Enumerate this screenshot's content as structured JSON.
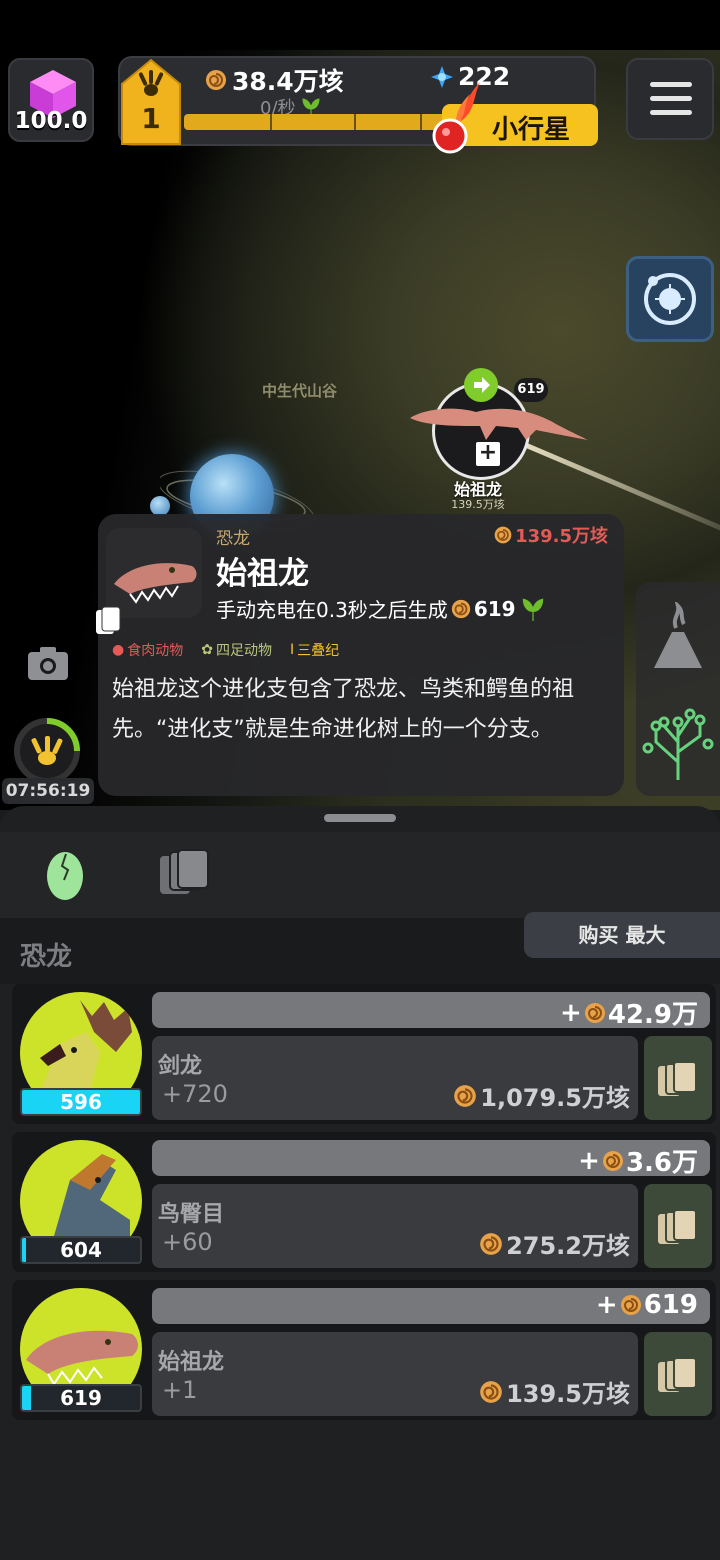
{
  "hud": {
    "cube_value": "100.0",
    "level": "1",
    "fossils": "38.4万垓",
    "rate": "0/秒",
    "gems": "222",
    "progress": 0.9,
    "asteroid_label": "小行星"
  },
  "map": {
    "region_label": "中生代山谷",
    "node_name": "始祖龙",
    "node_price": "139.5万垓",
    "node_count": "619"
  },
  "card": {
    "category": "恐龙",
    "price": "139.5万垓",
    "title": "始祖龙",
    "desc_prefix": "手动充电在0.3秒之后生成",
    "desc_amount": "619",
    "tags": [
      "食肉动物",
      "四足动物",
      "三叠纪"
    ],
    "body": "始祖龙这个进化支包含了恐龙、鸟类和鳄鱼的祖先。“进化支”就是生命进化树上的一个分支。"
  },
  "timer": "07:56:19",
  "panel": {
    "section_title": "恐龙",
    "buy_max_label": "购买 最大",
    "rows": [
      {
        "name": "剑龙",
        "plus": "+720",
        "cost": "1,079.5万垓",
        "gain": "42.9万",
        "level": "596",
        "level_fill": 1.0
      },
      {
        "name": "鸟臀目",
        "plus": "+60",
        "cost": "275.2万垓",
        "gain": "3.6万",
        "level": "604",
        "level_fill": 0.02
      },
      {
        "name": "始祖龙",
        "plus": "+1",
        "cost": "139.5万垓",
        "gain": "619",
        "level": "619",
        "level_fill": 0.08
      }
    ]
  },
  "colors": {
    "accent_yellow": "#f6c21f",
    "level_cyan": "#19d4f4",
    "price_red": "#e25b57"
  }
}
